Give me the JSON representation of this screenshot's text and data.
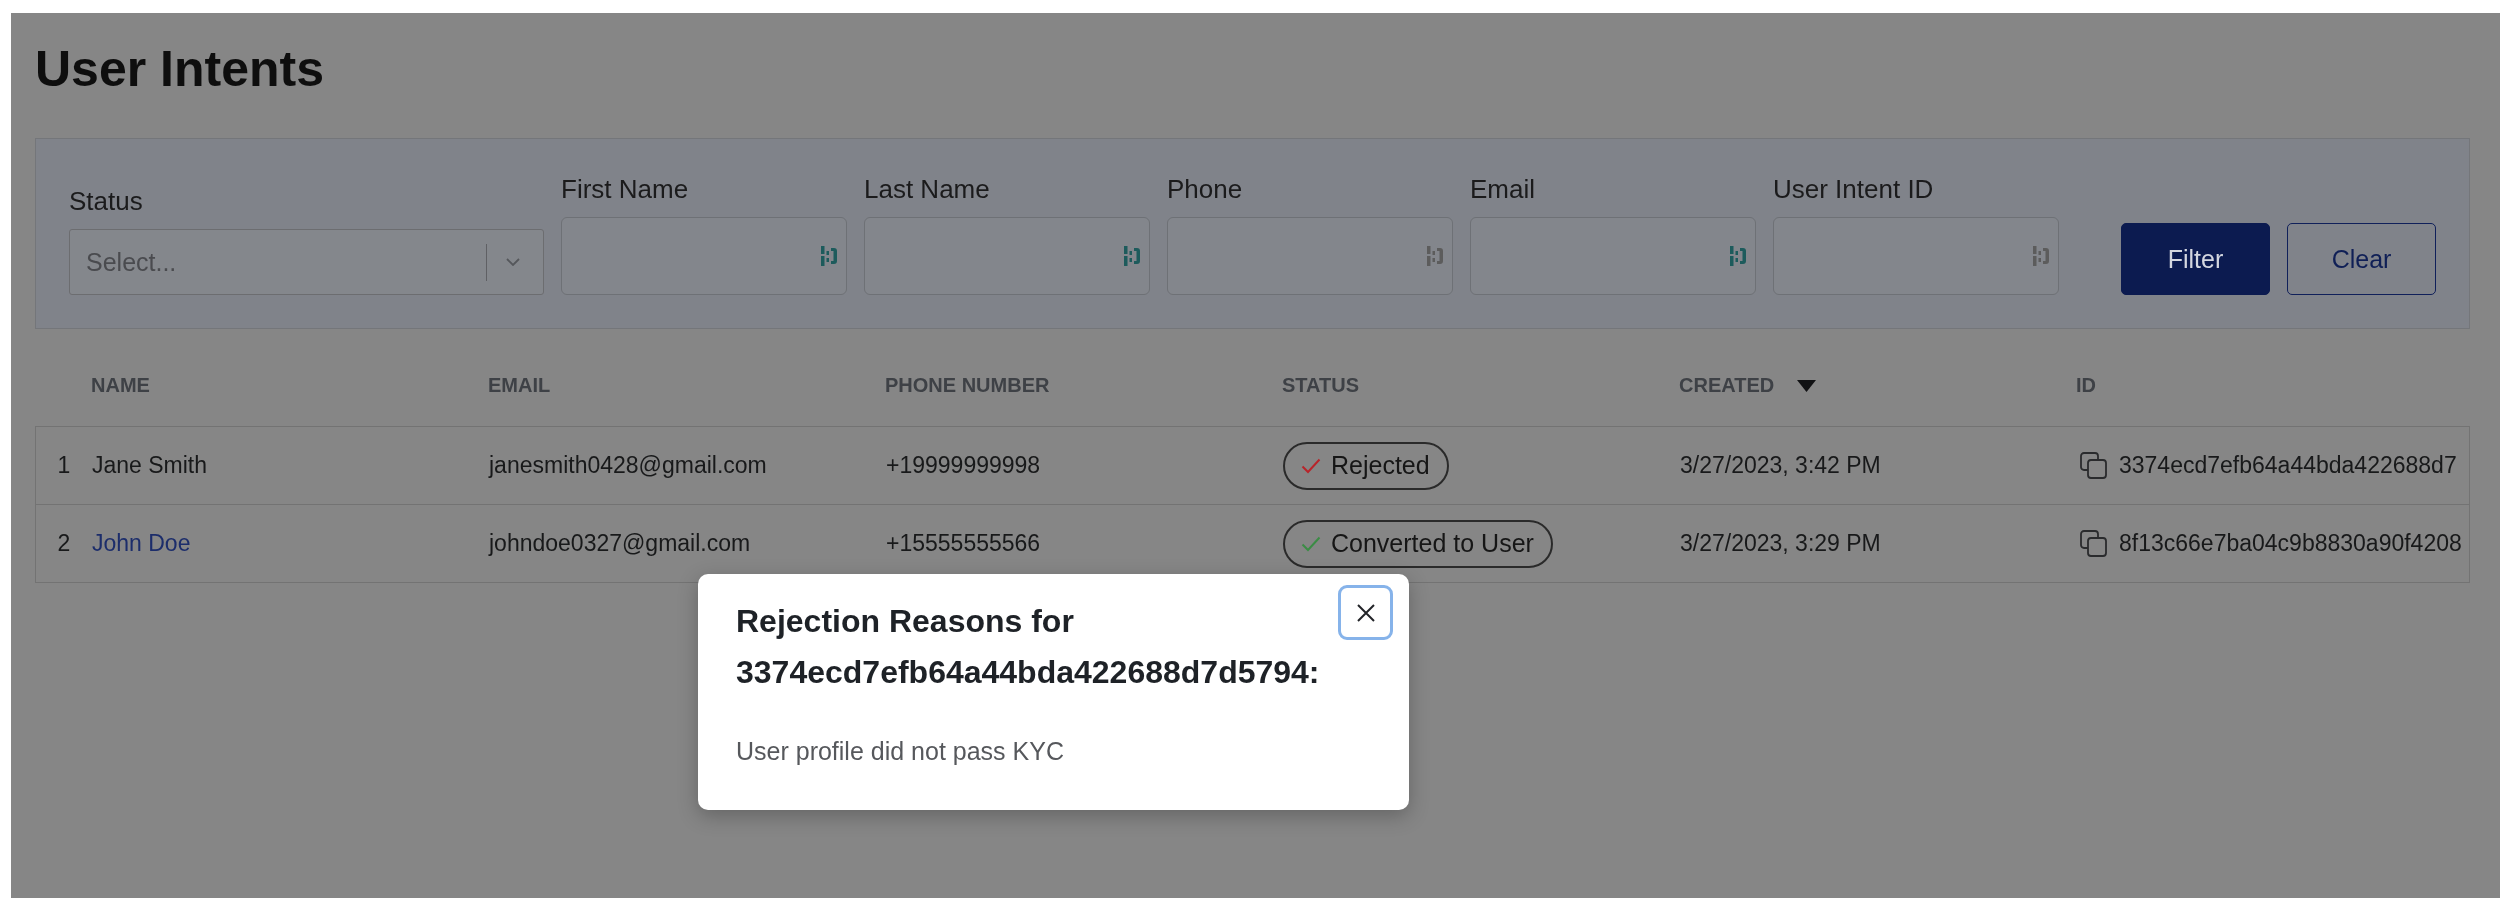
{
  "page": {
    "title": "User Intents"
  },
  "filters": {
    "fields": [
      {
        "kind": "select",
        "label": "Status",
        "placeholder": "Select..."
      },
      {
        "kind": "text",
        "label": "First Name",
        "color": "#1d5b5c"
      },
      {
        "kind": "text",
        "label": "Last Name",
        "color": "#1d5b5c"
      },
      {
        "kind": "text",
        "label": "Phone",
        "color": "#5c5c5c"
      },
      {
        "kind": "text",
        "label": "Email",
        "color": "#1d5b5c"
      },
      {
        "kind": "text",
        "label": "User Intent ID",
        "color": "#5c5c5c"
      }
    ],
    "buttons": [
      {
        "kind": "primary",
        "label": "Filter"
      },
      {
        "kind": "secondary",
        "label": "Clear"
      }
    ]
  },
  "table": {
    "columns": [
      {
        "label": "NAME",
        "sorted": false
      },
      {
        "label": "EMAIL",
        "sorted": false
      },
      {
        "label": "PHONE NUMBER",
        "sorted": false
      },
      {
        "label": "STATUS",
        "sorted": false
      },
      {
        "label": "CREATED",
        "sorted": true
      },
      {
        "label": "ID",
        "sorted": false
      }
    ],
    "rows": [
      {
        "number": "1",
        "name": "Jane Smith",
        "link": false,
        "email": "janesmith0428@gmail.com",
        "phone": "+19999999998",
        "status": {
          "label": "Rejected",
          "color": "#b8242a"
        },
        "created": "3/27/2023, 3:42 PM",
        "id": "3374ecd7efb64a44bda422688d7"
      },
      {
        "number": "2",
        "name": "John Doe",
        "link": true,
        "email": "johndoe0327@gmail.com",
        "phone": "+15555555566",
        "status": {
          "label": "Converted to User",
          "color": "#3b8c45"
        },
        "created": "3/27/2023, 3:29 PM",
        "id": "8f13c66e7ba04c9b8830a90f4208"
      }
    ]
  },
  "modal": {
    "title": "Rejection Reasons for 3374ecd7efb64a44bda422688d7d5794:",
    "message": "User profile did not pass KYC"
  }
}
